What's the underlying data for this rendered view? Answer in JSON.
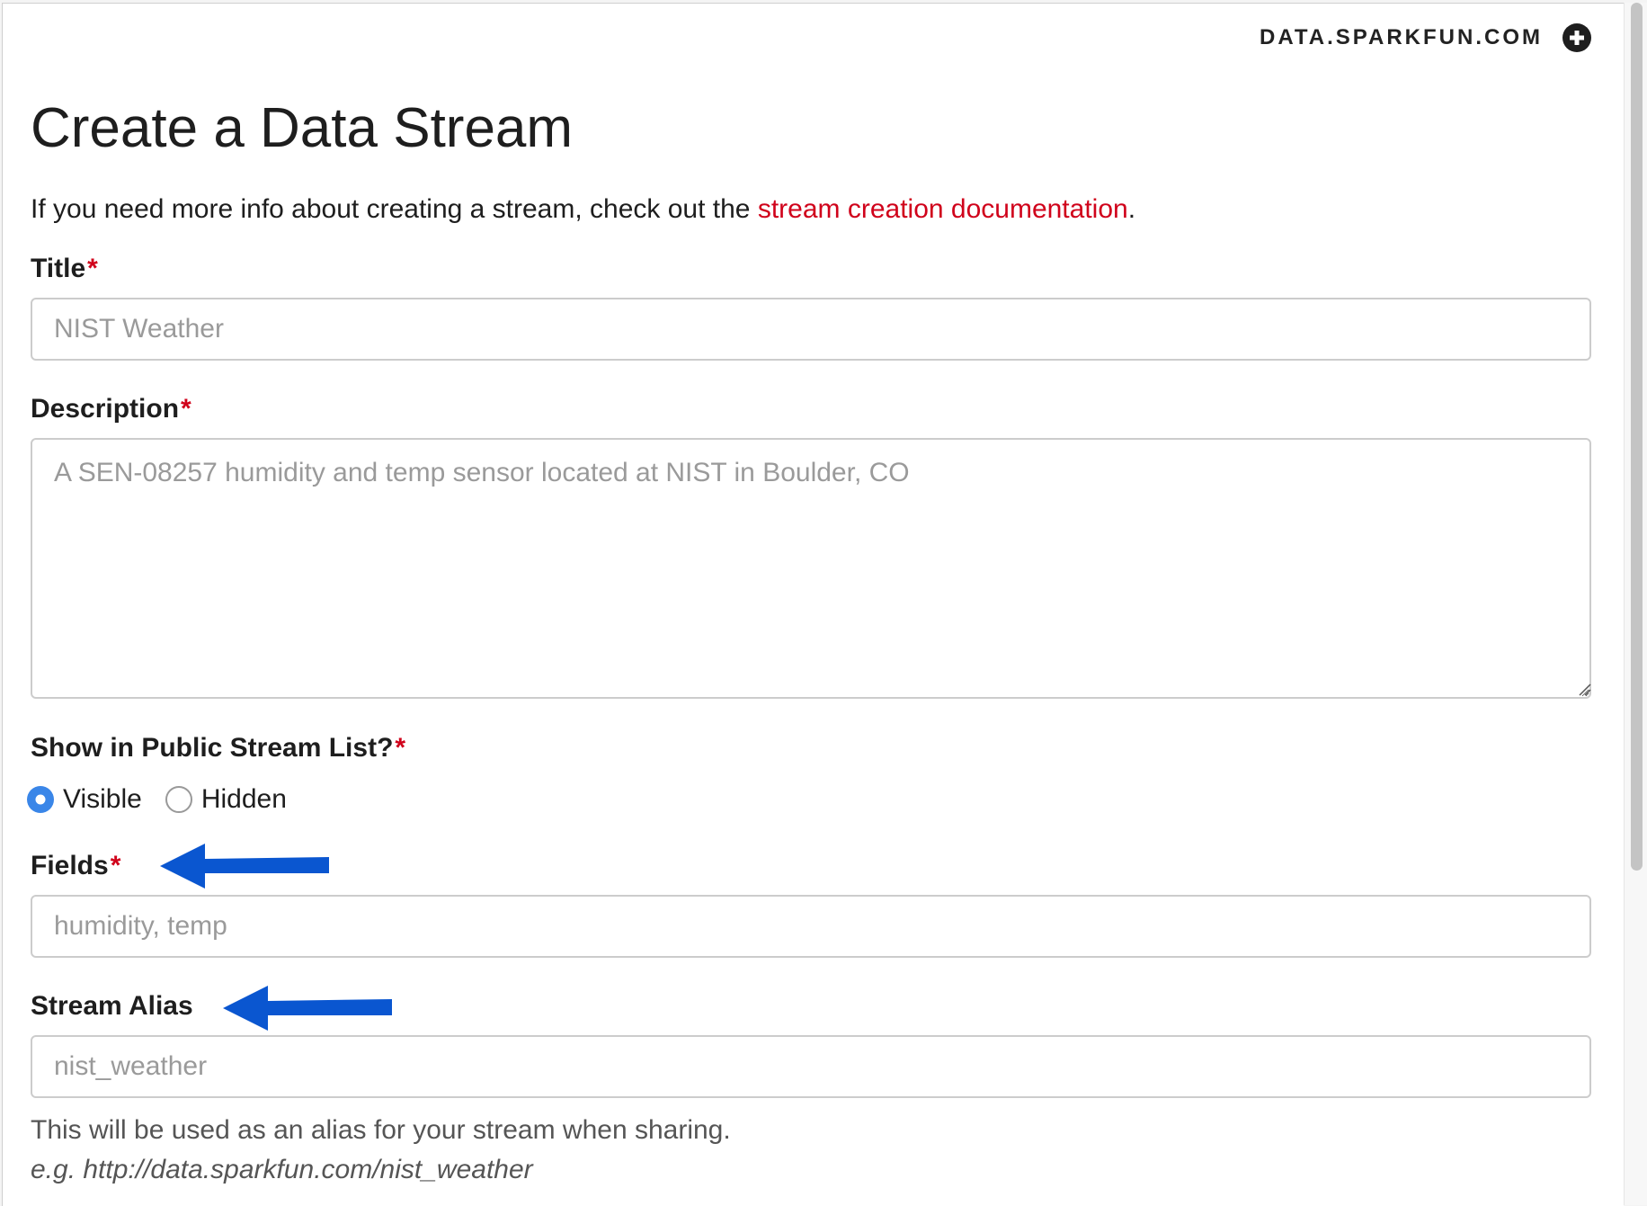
{
  "header": {
    "brand": "DATA.SPARKFUN.COM",
    "add_icon": "plus-circle-icon"
  },
  "page": {
    "title": "Create a Data Stream",
    "intro_prefix": "If you need more info about creating a stream, check out the ",
    "intro_link": "stream creation documentation",
    "intro_suffix": "."
  },
  "form": {
    "required_mark": "*",
    "title": {
      "label": "Title",
      "placeholder": "NIST Weather",
      "value": ""
    },
    "description": {
      "label": "Description",
      "placeholder": "A SEN-08257 humidity and temp sensor located at NIST in Boulder, CO",
      "value": ""
    },
    "visibility": {
      "label": "Show in Public Stream List?",
      "options": [
        "Visible",
        "Hidden"
      ],
      "selected": "Visible"
    },
    "fields": {
      "label": "Fields",
      "placeholder": "humidity, temp",
      "value": ""
    },
    "alias": {
      "label": "Stream Alias",
      "placeholder": "nist_weather",
      "value": "",
      "help": "This will be used as an alias for your stream when sharing.",
      "example": "e.g. http://data.sparkfun.com/nist_weather"
    }
  },
  "annotations": {
    "arrow_color": "#0a56d0"
  },
  "colors": {
    "link": "#d0021b",
    "required": "#d0021b",
    "radio_checked": "#3a86e8"
  }
}
